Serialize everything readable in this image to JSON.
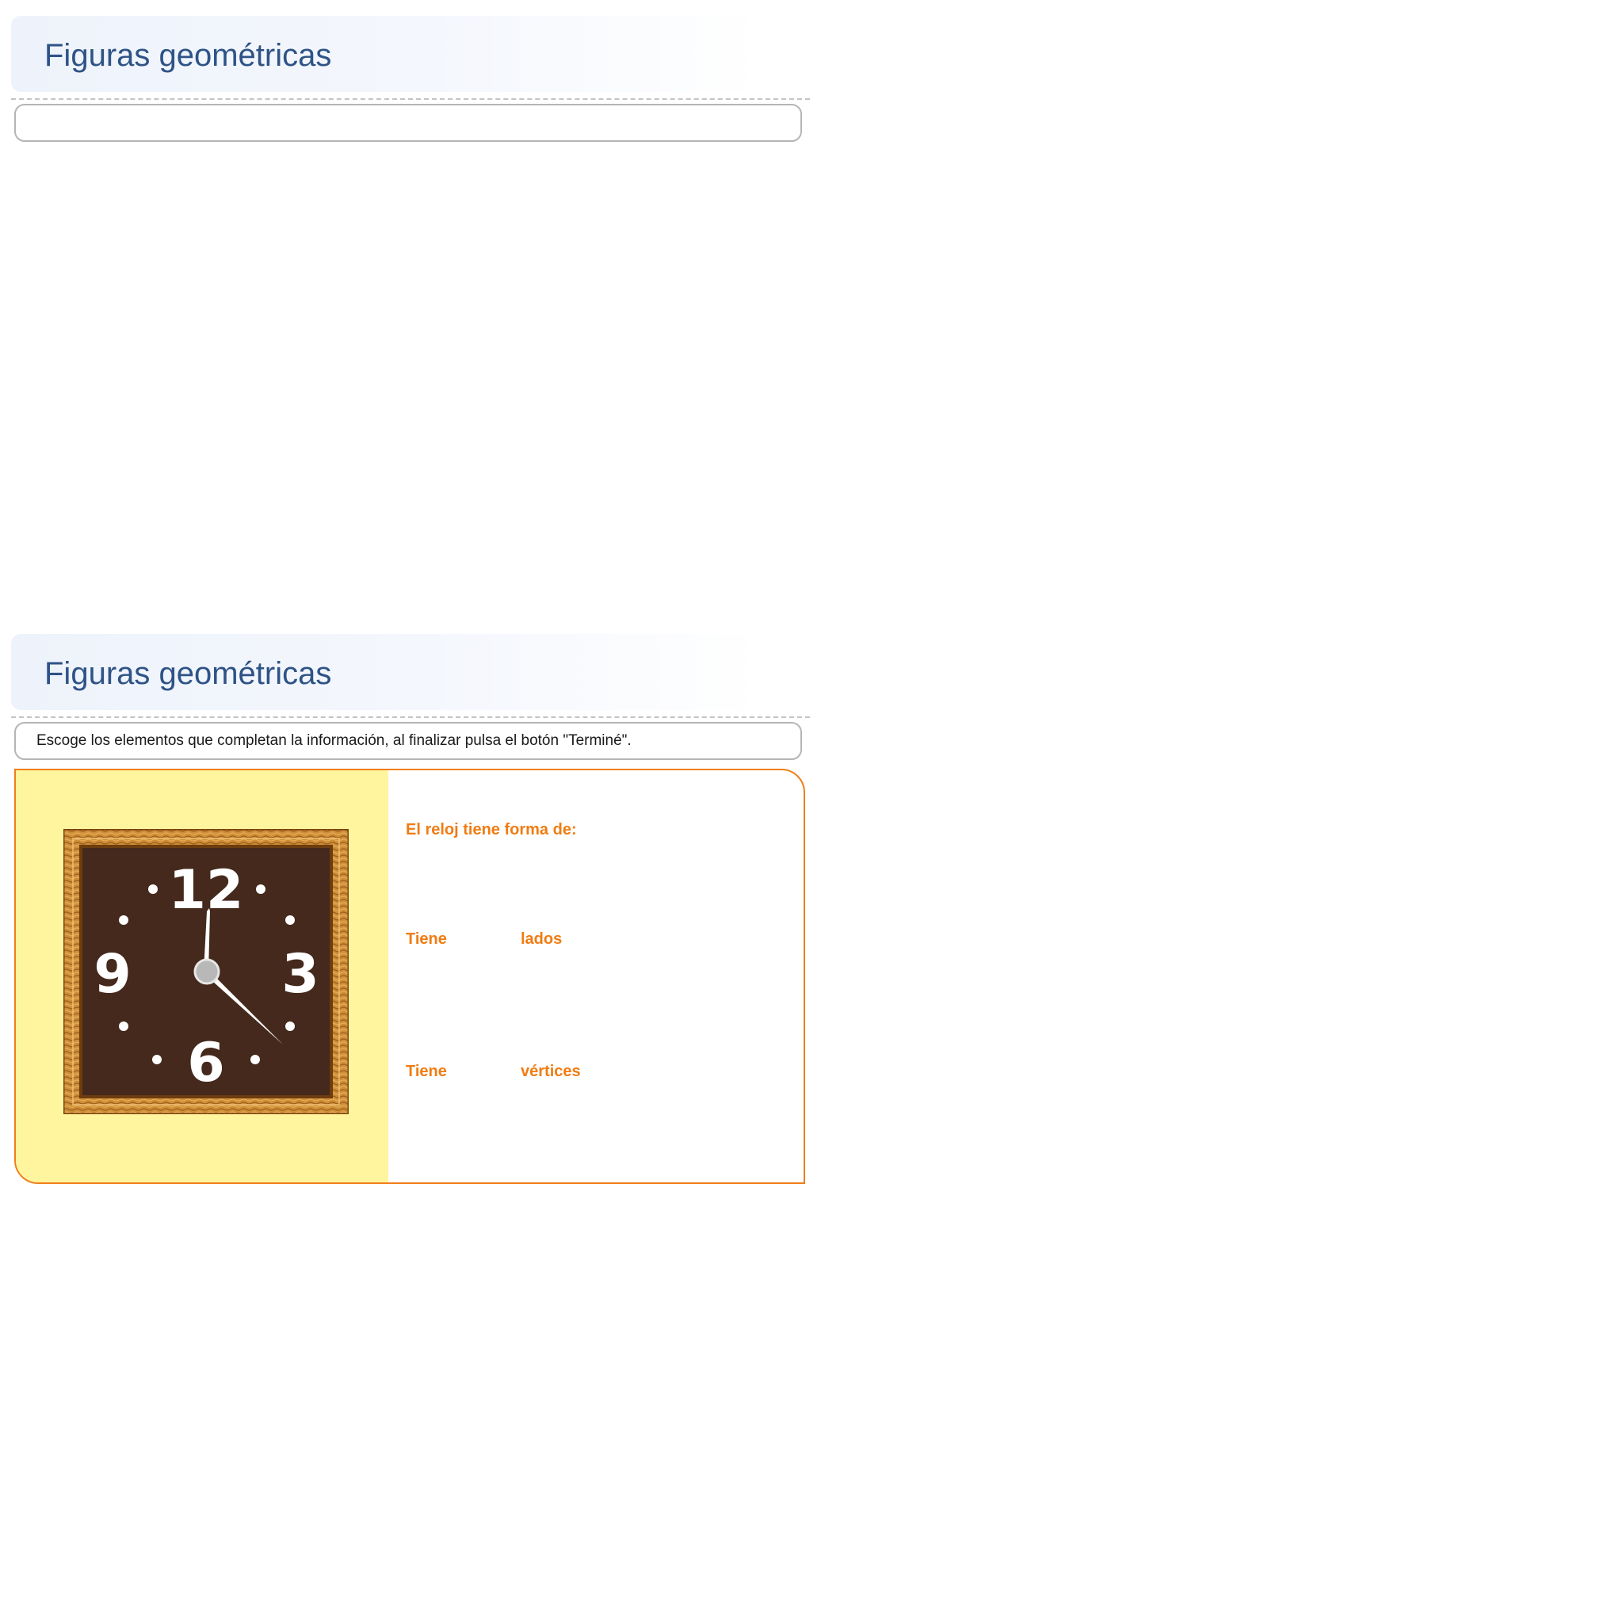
{
  "top_panel": {
    "title": "Figuras geométricas",
    "instructions": ""
  },
  "bottom_panel": {
    "title": "Figuras geométricas",
    "instructions": "Escoge los elementos que completan la información, al finalizar pulsa el botón \"Terminé\"."
  },
  "activity": {
    "question_shape": "El reloj tiene forma de:",
    "sides_prefix": "Tiene",
    "sides_suffix": "lados",
    "vertices_prefix": "Tiene",
    "vertices_suffix": "vértices"
  },
  "clock": {
    "numerals": {
      "twelve": "12",
      "three": "3",
      "six": "6",
      "nine": "9"
    },
    "colors": {
      "face": "#44291c",
      "frame_light": "#d9a04a",
      "frame_dark": "#8a5216",
      "numerals": "#ffffff",
      "center": "#b8b8b8"
    }
  },
  "colors": {
    "title": "#2e5386",
    "accent_orange": "#ef7f1a",
    "left_pane": "#fff59e"
  }
}
